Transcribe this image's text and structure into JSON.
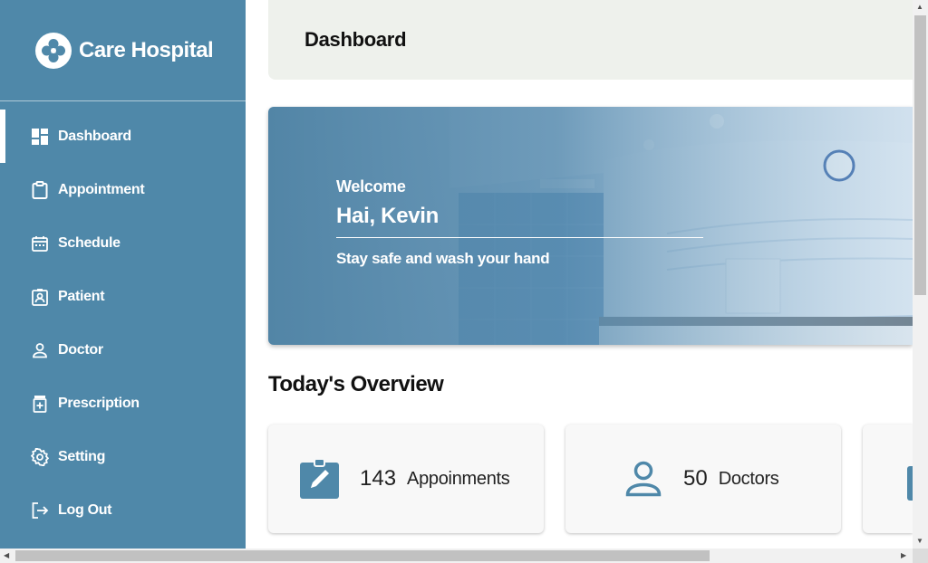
{
  "brand": {
    "name": "Care Hospital"
  },
  "sidebar": {
    "items": [
      {
        "label": "Dashboard",
        "icon": "dashboard-icon",
        "active": true
      },
      {
        "label": "Appointment",
        "icon": "clipboard-icon"
      },
      {
        "label": "Schedule",
        "icon": "calendar-icon"
      },
      {
        "label": "Patient",
        "icon": "patient-badge-icon"
      },
      {
        "label": "Doctor",
        "icon": "person-icon"
      },
      {
        "label": "Prescription",
        "icon": "medicine-icon"
      },
      {
        "label": "Setting",
        "icon": "gear-icon"
      },
      {
        "label": "Log Out",
        "icon": "logout-icon"
      }
    ]
  },
  "header": {
    "title": "Dashboard"
  },
  "banner": {
    "welcome": "Welcome",
    "greeting": "Hai, Kevin",
    "tagline": "Stay safe and wash your hand"
  },
  "overview": {
    "title": "Today's Overview",
    "cards": [
      {
        "count": "143",
        "label": "Appoinments",
        "icon": "edit-clipboard-icon"
      },
      {
        "count": "50",
        "label": "Doctors",
        "icon": "person-icon"
      }
    ]
  },
  "colors": {
    "primary": "#4f88a9",
    "header_bg": "#eef1ec",
    "card_bg": "#f8f8f8"
  }
}
